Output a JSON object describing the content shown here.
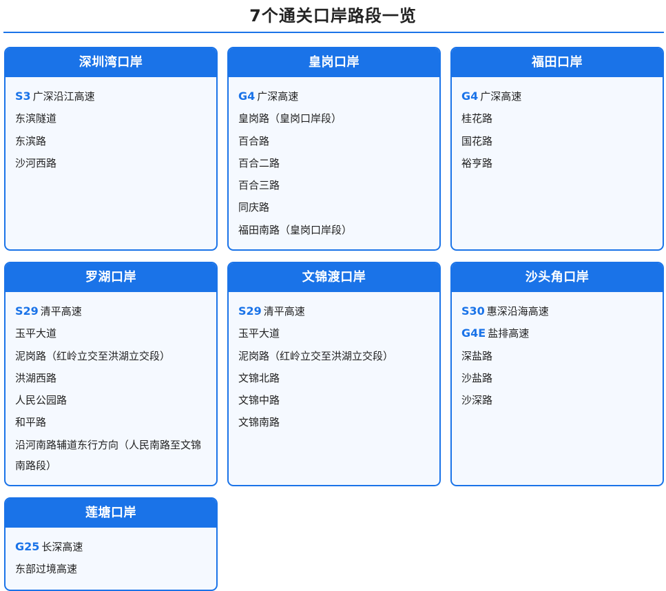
{
  "title": "7个通关口岸路段一览",
  "colors": {
    "accent": "#1a73e8",
    "card_bg": "#f5f9ff",
    "text": "#222222"
  },
  "ports": [
    {
      "name": "深圳湾口岸",
      "roads": [
        {
          "code": "S3",
          "name": "广深沿江高速"
        },
        {
          "code": "",
          "name": "东滨隧道"
        },
        {
          "code": "",
          "name": "东滨路"
        },
        {
          "code": "",
          "name": "沙河西路"
        }
      ]
    },
    {
      "name": "皇岗口岸",
      "roads": [
        {
          "code": "G4",
          "name": "广深高速"
        },
        {
          "code": "",
          "name": "皇岗路（皇岗口岸段）"
        },
        {
          "code": "",
          "name": "百合路"
        },
        {
          "code": "",
          "name": "百合二路"
        },
        {
          "code": "",
          "name": "百合三路"
        },
        {
          "code": "",
          "name": "同庆路"
        },
        {
          "code": "",
          "name": "福田南路（皇岗口岸段）"
        }
      ]
    },
    {
      "name": "福田口岸",
      "roads": [
        {
          "code": "G4",
          "name": "广深高速"
        },
        {
          "code": "",
          "name": "桂花路"
        },
        {
          "code": "",
          "name": "国花路"
        },
        {
          "code": "",
          "name": "裕亨路"
        }
      ]
    },
    {
      "name": "罗湖口岸",
      "roads": [
        {
          "code": "S29",
          "name": "清平高速"
        },
        {
          "code": "",
          "name": "玉平大道"
        },
        {
          "code": "",
          "name": "泥岗路（红岭立交至洪湖立交段）"
        },
        {
          "code": "",
          "name": "洪湖西路"
        },
        {
          "code": "",
          "name": "人民公园路"
        },
        {
          "code": "",
          "name": "和平路"
        },
        {
          "code": "",
          "name": "沿河南路辅道东行方向（人民南路至文锦南路段）"
        }
      ]
    },
    {
      "name": "文锦渡口岸",
      "roads": [
        {
          "code": "S29",
          "name": "清平高速"
        },
        {
          "code": "",
          "name": "玉平大道"
        },
        {
          "code": "",
          "name": "泥岗路（红岭立交至洪湖立交段）"
        },
        {
          "code": "",
          "name": "文锦北路"
        },
        {
          "code": "",
          "name": "文锦中路"
        },
        {
          "code": "",
          "name": "文锦南路"
        }
      ]
    },
    {
      "name": "沙头角口岸",
      "roads": [
        {
          "code": "S30",
          "name": "惠深沿海高速"
        },
        {
          "code": "G4E",
          "name": "盐排高速"
        },
        {
          "code": "",
          "name": "深盐路"
        },
        {
          "code": "",
          "name": "沙盐路"
        },
        {
          "code": "",
          "name": "沙深路"
        }
      ]
    },
    {
      "name": "莲塘口岸",
      "roads": [
        {
          "code": "G25",
          "name": "长深高速"
        },
        {
          "code": "",
          "name": "东部过境高速"
        }
      ]
    }
  ]
}
